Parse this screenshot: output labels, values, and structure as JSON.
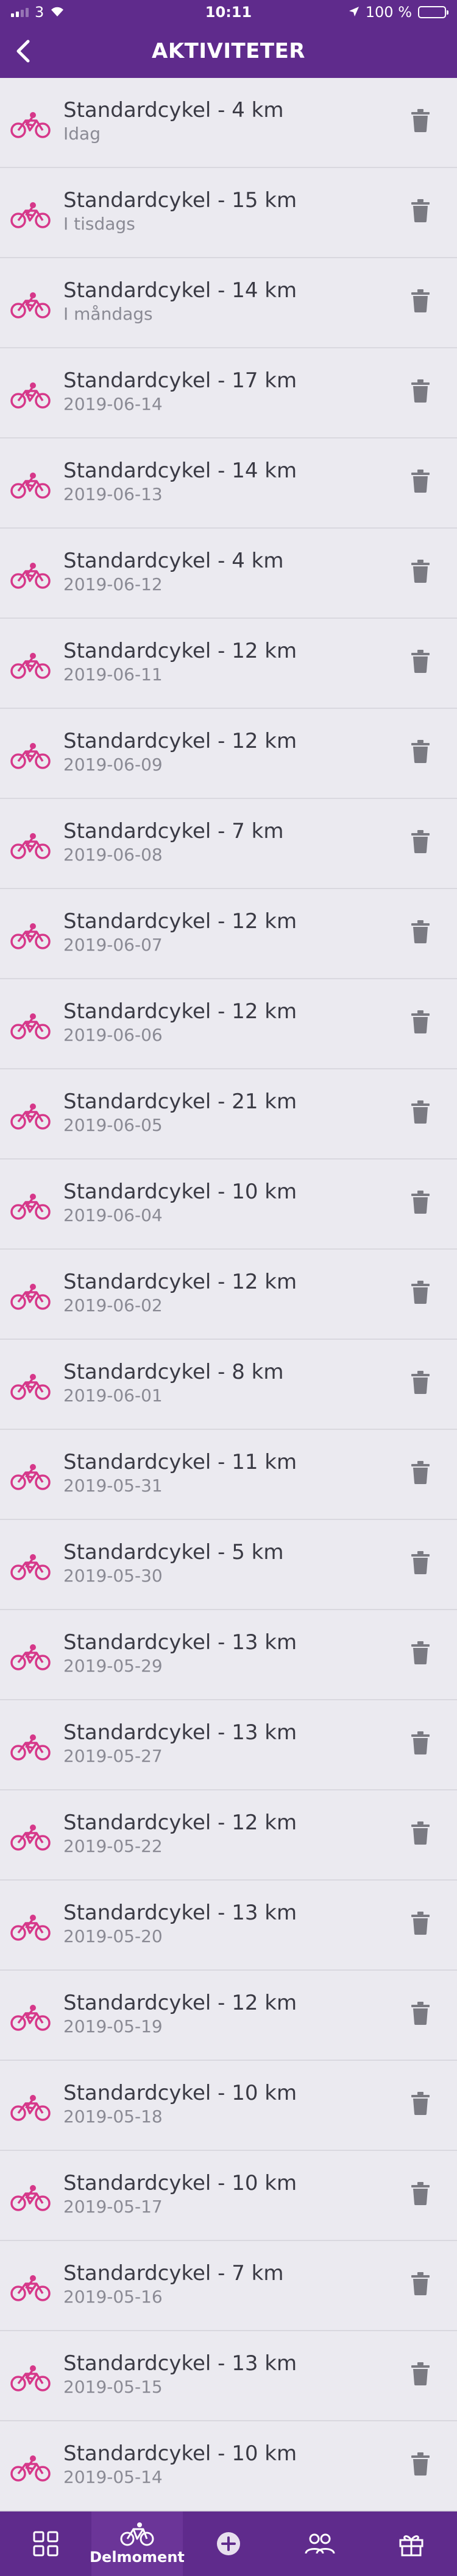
{
  "status": {
    "carrier": "3",
    "time": "10:11",
    "battery": "100 %"
  },
  "header": {
    "title": "AKTIVITETER"
  },
  "activities": [
    {
      "title": "Standardcykel - 4 km",
      "date": "Idag"
    },
    {
      "title": "Standardcykel - 15 km",
      "date": "I tisdags"
    },
    {
      "title": "Standardcykel - 14 km",
      "date": "I måndags"
    },
    {
      "title": "Standardcykel - 17 km",
      "date": "2019-06-14"
    },
    {
      "title": "Standardcykel - 14 km",
      "date": "2019-06-13"
    },
    {
      "title": "Standardcykel - 4 km",
      "date": "2019-06-12"
    },
    {
      "title": "Standardcykel - 12 km",
      "date": "2019-06-11"
    },
    {
      "title": "Standardcykel - 12 km",
      "date": "2019-06-09"
    },
    {
      "title": "Standardcykel - 7 km",
      "date": "2019-06-08"
    },
    {
      "title": "Standardcykel - 12 km",
      "date": "2019-06-07"
    },
    {
      "title": "Standardcykel - 12 km",
      "date": "2019-06-06"
    },
    {
      "title": "Standardcykel - 21 km",
      "date": "2019-06-05"
    },
    {
      "title": "Standardcykel - 10 km",
      "date": "2019-06-04"
    },
    {
      "title": "Standardcykel - 12 km",
      "date": "2019-06-02"
    },
    {
      "title": "Standardcykel - 8 km",
      "date": "2019-06-01"
    },
    {
      "title": "Standardcykel - 11 km",
      "date": "2019-05-31"
    },
    {
      "title": "Standardcykel - 5 km",
      "date": "2019-05-30"
    },
    {
      "title": "Standardcykel - 13 km",
      "date": "2019-05-29"
    },
    {
      "title": "Standardcykel - 13 km",
      "date": "2019-05-27"
    },
    {
      "title": "Standardcykel - 12 km",
      "date": "2019-05-22"
    },
    {
      "title": "Standardcykel - 13 km",
      "date": "2019-05-20"
    },
    {
      "title": "Standardcykel - 12 km",
      "date": "2019-05-19"
    },
    {
      "title": "Standardcykel - 10 km",
      "date": "2019-05-18"
    },
    {
      "title": "Standardcykel - 10 km",
      "date": "2019-05-17"
    },
    {
      "title": "Standardcykel - 7 km",
      "date": "2019-05-16"
    },
    {
      "title": "Standardcykel - 13 km",
      "date": "2019-05-15"
    },
    {
      "title": "Standardcykel - 10 km",
      "date": "2019-05-14"
    }
  ],
  "tabs": [
    {
      "icon": "grid-icon",
      "label": ""
    },
    {
      "icon": "bike-icon",
      "label": "Delmoment"
    },
    {
      "icon": "plus-circle-icon",
      "label": ""
    },
    {
      "icon": "people-icon",
      "label": ""
    },
    {
      "icon": "gift-icon",
      "label": ""
    }
  ],
  "colors": {
    "brand": "#5f2b8c",
    "bike": "#d6388a",
    "trash": "#7a7a82",
    "background": "#ebeaf0"
  }
}
